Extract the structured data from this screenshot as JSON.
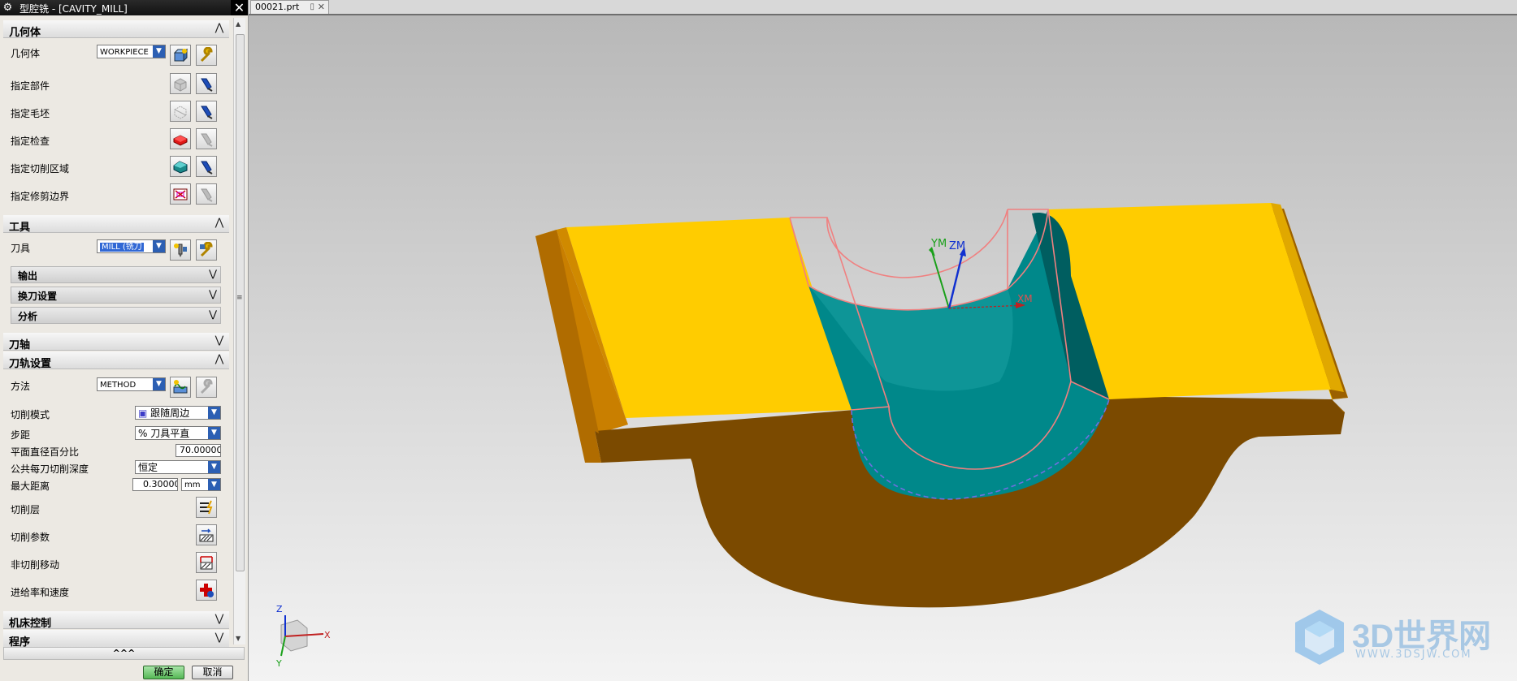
{
  "dialog": {
    "title": "型腔铣 - [CAVITY_MILL]",
    "ok_label": "确定",
    "cancel_label": "取消",
    "geometry": {
      "header": "几何体",
      "geometry_label": "几何体",
      "geometry_value": "WORKPIECE",
      "specify_part": "指定部件",
      "specify_blank": "指定毛坯",
      "specify_check": "指定检查",
      "specify_cut_area": "指定切削区域",
      "specify_trim": "指定修剪边界"
    },
    "tool": {
      "header": "工具",
      "tool_label": "刀具",
      "tool_value": "MILL (铣刀",
      "output": "输出",
      "tool_change": "换刀设置",
      "analysis": "分析"
    },
    "tool_axis": {
      "header": "刀轴"
    },
    "path_settings": {
      "header": "刀轨设置",
      "method_label": "方法",
      "method_value": "METHOD",
      "cut_pattern_label": "切削模式",
      "cut_pattern_value": "跟随周边",
      "stepover_label": "步距",
      "stepover_value": "% 刀具平直",
      "percent_label": "平面直径百分比",
      "percent_value": "70.00000",
      "depth_label": "公共每刀切削深度",
      "depth_value": "恒定",
      "max_dist_label": "最大距离",
      "max_dist_value": "0.30000",
      "max_dist_unit": "mm",
      "cut_levels": "切削层",
      "cut_params": "切削参数",
      "non_cut": "非切削移动",
      "feeds": "进给率和速度"
    },
    "machine_control": {
      "header": "机床控制"
    },
    "program": {
      "header": "程序"
    },
    "collapse_all": "^^^"
  },
  "tab": {
    "label": "00021.prt"
  },
  "viewport": {
    "wcs": {
      "x": "XM",
      "y": "YM",
      "z": "ZM"
    },
    "triad": {
      "x": "X",
      "y": "Y",
      "z": "Z"
    },
    "watermark": {
      "title": "3D世界网",
      "url": "WWW.3DSJW.COM"
    },
    "colors": {
      "top_face": "#ffcc00",
      "side_face": "#7b4a00",
      "cavity": "#00888a",
      "edges": "#f08080"
    }
  }
}
